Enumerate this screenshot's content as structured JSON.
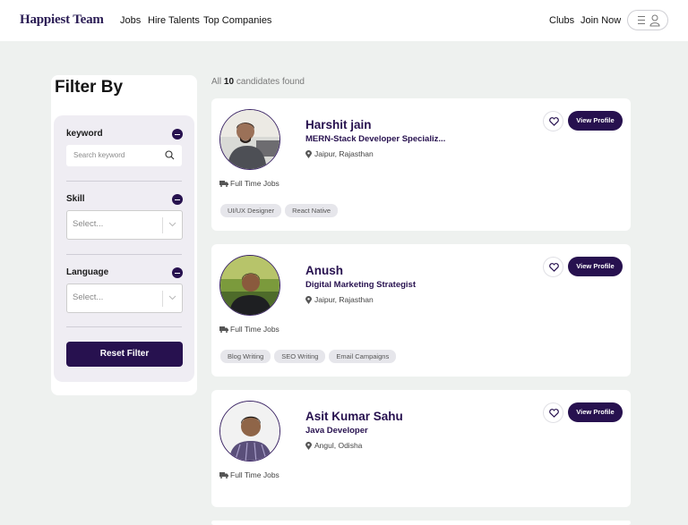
{
  "header": {
    "logo": "Happiest Team",
    "nav": [
      "Jobs",
      "Hire Talents",
      "Top Companies"
    ],
    "right_nav": [
      "Clubs",
      "Join Now"
    ]
  },
  "filter": {
    "title": "Filter By",
    "keyword_label": "keyword",
    "search_placeholder": "Search keyword",
    "skill_label": "Skill",
    "skill_placeholder": "Select...",
    "language_label": "Language",
    "language_placeholder": "Select...",
    "reset_label": "Reset Filter"
  },
  "results": {
    "prefix": "All",
    "count": "10",
    "suffix": "candidates found"
  },
  "candidates": [
    {
      "name": "Harshit jain",
      "role": "MERN-Stack Developer Specializ...",
      "location": "Jaipur, Rajasthan",
      "job_type": "Full Time Jobs",
      "tags": [
        "UI/UX Designer",
        "React Native"
      ],
      "view_label": "View Profile"
    },
    {
      "name": "Anush",
      "role": "Digital Marketing Strategist",
      "location": "Jaipur, Rajasthan",
      "job_type": "Full Time Jobs",
      "tags": [
        "Blog Writing",
        "SEO Writing",
        "Email Campaigns"
      ],
      "view_label": "View Profile"
    },
    {
      "name": "Asit Kumar Sahu",
      "role": "Java Developer",
      "location": "Angul, Odisha",
      "job_type": "Full Time Jobs",
      "tags": [],
      "view_label": "View Profile"
    }
  ],
  "icons": {
    "search": "search-icon",
    "collapse": "minus-circle-icon",
    "chevron": "chevron-down-icon",
    "location": "map-pin-icon",
    "job": "truck-icon",
    "heart": "heart-icon",
    "menu": "hamburger-icon",
    "user": "user-icon"
  },
  "colors": {
    "brand": "#27114f",
    "background": "#eef1ef",
    "card": "#ffffff",
    "tag": "#e6e6eb"
  }
}
